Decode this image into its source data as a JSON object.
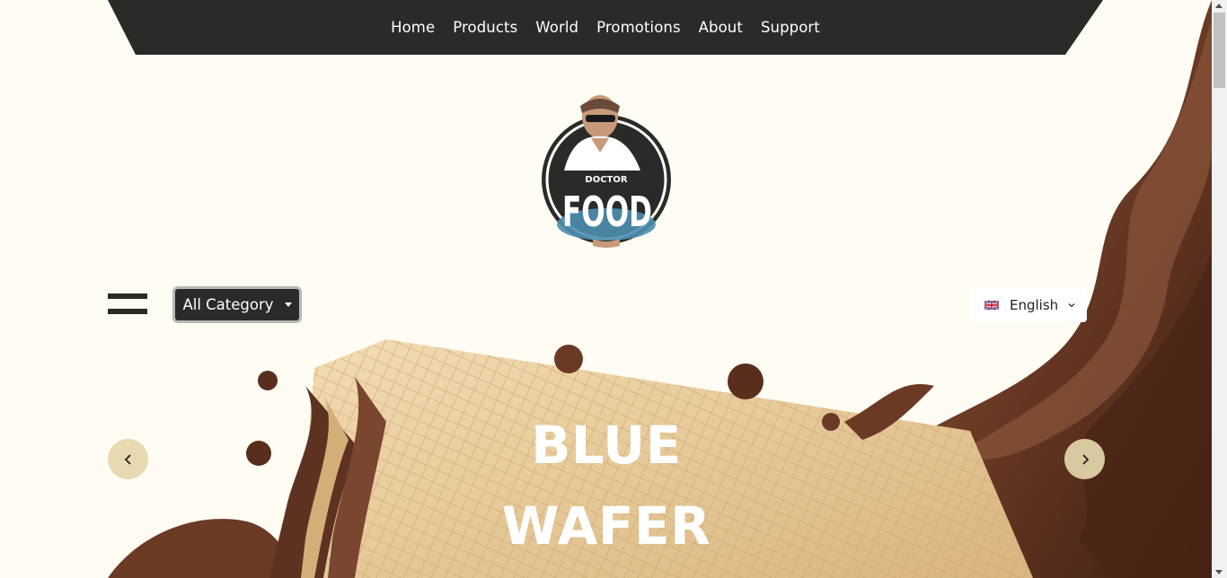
{
  "nav": {
    "items": [
      {
        "label": "Home"
      },
      {
        "label": "Products"
      },
      {
        "label": "World"
      },
      {
        "label": "Promotions"
      },
      {
        "label": "About"
      },
      {
        "label": "Support"
      }
    ]
  },
  "logo": {
    "top_text": "DOCTOR",
    "main_text": "FOOD"
  },
  "category": {
    "label": "All Category"
  },
  "language": {
    "selected": "English",
    "flag": "uk-flag-icon"
  },
  "hero": {
    "line1": "BLUE",
    "line2": "WAFER"
  },
  "colors": {
    "background": "#fffdf3",
    "nav_bg": "#2b2a28",
    "chocolate": "#6b3a25",
    "wafer": "#e9cc9a",
    "arrow_bg": "#e8d9b0"
  }
}
